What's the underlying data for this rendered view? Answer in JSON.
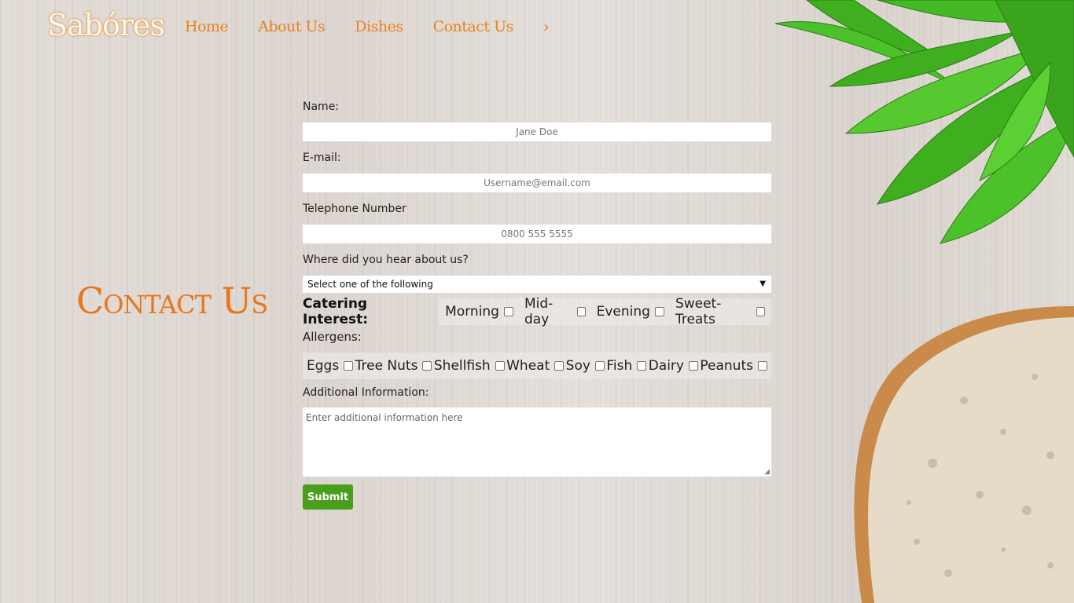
{
  "brand": {
    "logo": "Sabóres"
  },
  "nav": {
    "items": [
      "Home",
      "About Us",
      "Dishes",
      "Contact Us"
    ],
    "more_icon": "chevron-right-icon"
  },
  "page": {
    "title": "Contact Us"
  },
  "form": {
    "name_label": "Name:",
    "name_placeholder": "Jane Doe",
    "email_label": "E-mail:",
    "email_placeholder": "Username@email.com",
    "phone_label": "Telephone Number",
    "phone_placeholder": "0800 555 5555",
    "source_label": "Where did you hear about us?",
    "source_selected": "Select one of the following",
    "catering_label": "Catering Interest:",
    "catering_options": [
      "Morning",
      "Mid-day",
      "Evening",
      "Sweet-Treats"
    ],
    "allergens_label": "Allergens:",
    "allergen_options": [
      "Eggs",
      "Tree Nuts",
      "Shellfish",
      "Wheat",
      "Soy",
      "Fish",
      "Dairy",
      "Peanuts"
    ],
    "info_label": "Additional Information:",
    "info_placeholder": "Enter additional information here",
    "submit_label": "Submit"
  },
  "colors": {
    "accent": "#e8841f",
    "submit": "#4a9e1d"
  }
}
